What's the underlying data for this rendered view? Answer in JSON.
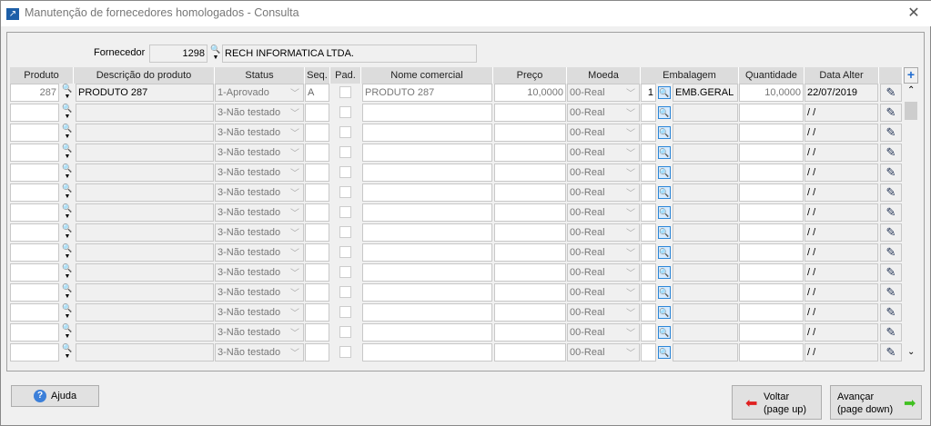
{
  "window": {
    "title": "Manutenção de fornecedores homologados - Consulta",
    "close": "✕"
  },
  "fornecedor": {
    "label": "Fornecedor",
    "code": "1298",
    "name": "RECH INFORMATICA LTDA."
  },
  "columns": [
    "Produto",
    "Descrição do produto",
    "Status",
    "Seq.",
    "Pad.",
    "Nome comercial",
    "Preço",
    "Moeda",
    "Embalagem",
    "Quantidade",
    "Data Alter"
  ],
  "add_icon": "plus-icon",
  "rows": [
    {
      "produto": "287",
      "descricao": "PRODUTO 287",
      "status": "1-Aprovado",
      "seq": "A",
      "pad": false,
      "nome": "PRODUTO 287",
      "preco": "10,0000",
      "moeda": "00-Real",
      "emb_qtd": "1",
      "emb_desc": "EMB.GERAL",
      "quantidade": "10,0000",
      "data": "22/07/2019"
    },
    {
      "produto": "",
      "descricao": "",
      "status": "3-Não testado",
      "seq": "",
      "pad": false,
      "nome": "",
      "preco": "",
      "moeda": "00-Real",
      "emb_qtd": "",
      "emb_desc": "",
      "quantidade": "",
      "data": " / /"
    },
    {
      "produto": "",
      "descricao": "",
      "status": "3-Não testado",
      "seq": "",
      "pad": false,
      "nome": "",
      "preco": "",
      "moeda": "00-Real",
      "emb_qtd": "",
      "emb_desc": "",
      "quantidade": "",
      "data": " / /"
    },
    {
      "produto": "",
      "descricao": "",
      "status": "3-Não testado",
      "seq": "",
      "pad": false,
      "nome": "",
      "preco": "",
      "moeda": "00-Real",
      "emb_qtd": "",
      "emb_desc": "",
      "quantidade": "",
      "data": " / /"
    },
    {
      "produto": "",
      "descricao": "",
      "status": "3-Não testado",
      "seq": "",
      "pad": false,
      "nome": "",
      "preco": "",
      "moeda": "00-Real",
      "emb_qtd": "",
      "emb_desc": "",
      "quantidade": "",
      "data": " / /"
    },
    {
      "produto": "",
      "descricao": "",
      "status": "3-Não testado",
      "seq": "",
      "pad": false,
      "nome": "",
      "preco": "",
      "moeda": "00-Real",
      "emb_qtd": "",
      "emb_desc": "",
      "quantidade": "",
      "data": " / /"
    },
    {
      "produto": "",
      "descricao": "",
      "status": "3-Não testado",
      "seq": "",
      "pad": false,
      "nome": "",
      "preco": "",
      "moeda": "00-Real",
      "emb_qtd": "",
      "emb_desc": "",
      "quantidade": "",
      "data": " / /"
    },
    {
      "produto": "",
      "descricao": "",
      "status": "3-Não testado",
      "seq": "",
      "pad": false,
      "nome": "",
      "preco": "",
      "moeda": "00-Real",
      "emb_qtd": "",
      "emb_desc": "",
      "quantidade": "",
      "data": " / /"
    },
    {
      "produto": "",
      "descricao": "",
      "status": "3-Não testado",
      "seq": "",
      "pad": false,
      "nome": "",
      "preco": "",
      "moeda": "00-Real",
      "emb_qtd": "",
      "emb_desc": "",
      "quantidade": "",
      "data": " / /"
    },
    {
      "produto": "",
      "descricao": "",
      "status": "3-Não testado",
      "seq": "",
      "pad": false,
      "nome": "",
      "preco": "",
      "moeda": "00-Real",
      "emb_qtd": "",
      "emb_desc": "",
      "quantidade": "",
      "data": " / /"
    },
    {
      "produto": "",
      "descricao": "",
      "status": "3-Não testado",
      "seq": "",
      "pad": false,
      "nome": "",
      "preco": "",
      "moeda": "00-Real",
      "emb_qtd": "",
      "emb_desc": "",
      "quantidade": "",
      "data": " / /"
    },
    {
      "produto": "",
      "descricao": "",
      "status": "3-Não testado",
      "seq": "",
      "pad": false,
      "nome": "",
      "preco": "",
      "moeda": "00-Real",
      "emb_qtd": "",
      "emb_desc": "",
      "quantidade": "",
      "data": " / /"
    },
    {
      "produto": "",
      "descricao": "",
      "status": "3-Não testado",
      "seq": "",
      "pad": false,
      "nome": "",
      "preco": "",
      "moeda": "00-Real",
      "emb_qtd": "",
      "emb_desc": "",
      "quantidade": "",
      "data": " / /"
    },
    {
      "produto": "",
      "descricao": "",
      "status": "3-Não testado",
      "seq": "",
      "pad": false,
      "nome": "",
      "preco": "",
      "moeda": "00-Real",
      "emb_qtd": "",
      "emb_desc": "",
      "quantidade": "",
      "data": " / /"
    }
  ],
  "buttons": {
    "help": "Ajuda",
    "back": "Voltar",
    "back_hint": "(page up)",
    "next": "Avançar",
    "next_hint": "(page down)"
  },
  "colors": {
    "accent": "#2a86d8",
    "back_arrow": "#e02020",
    "next_arrow": "#40c020"
  }
}
